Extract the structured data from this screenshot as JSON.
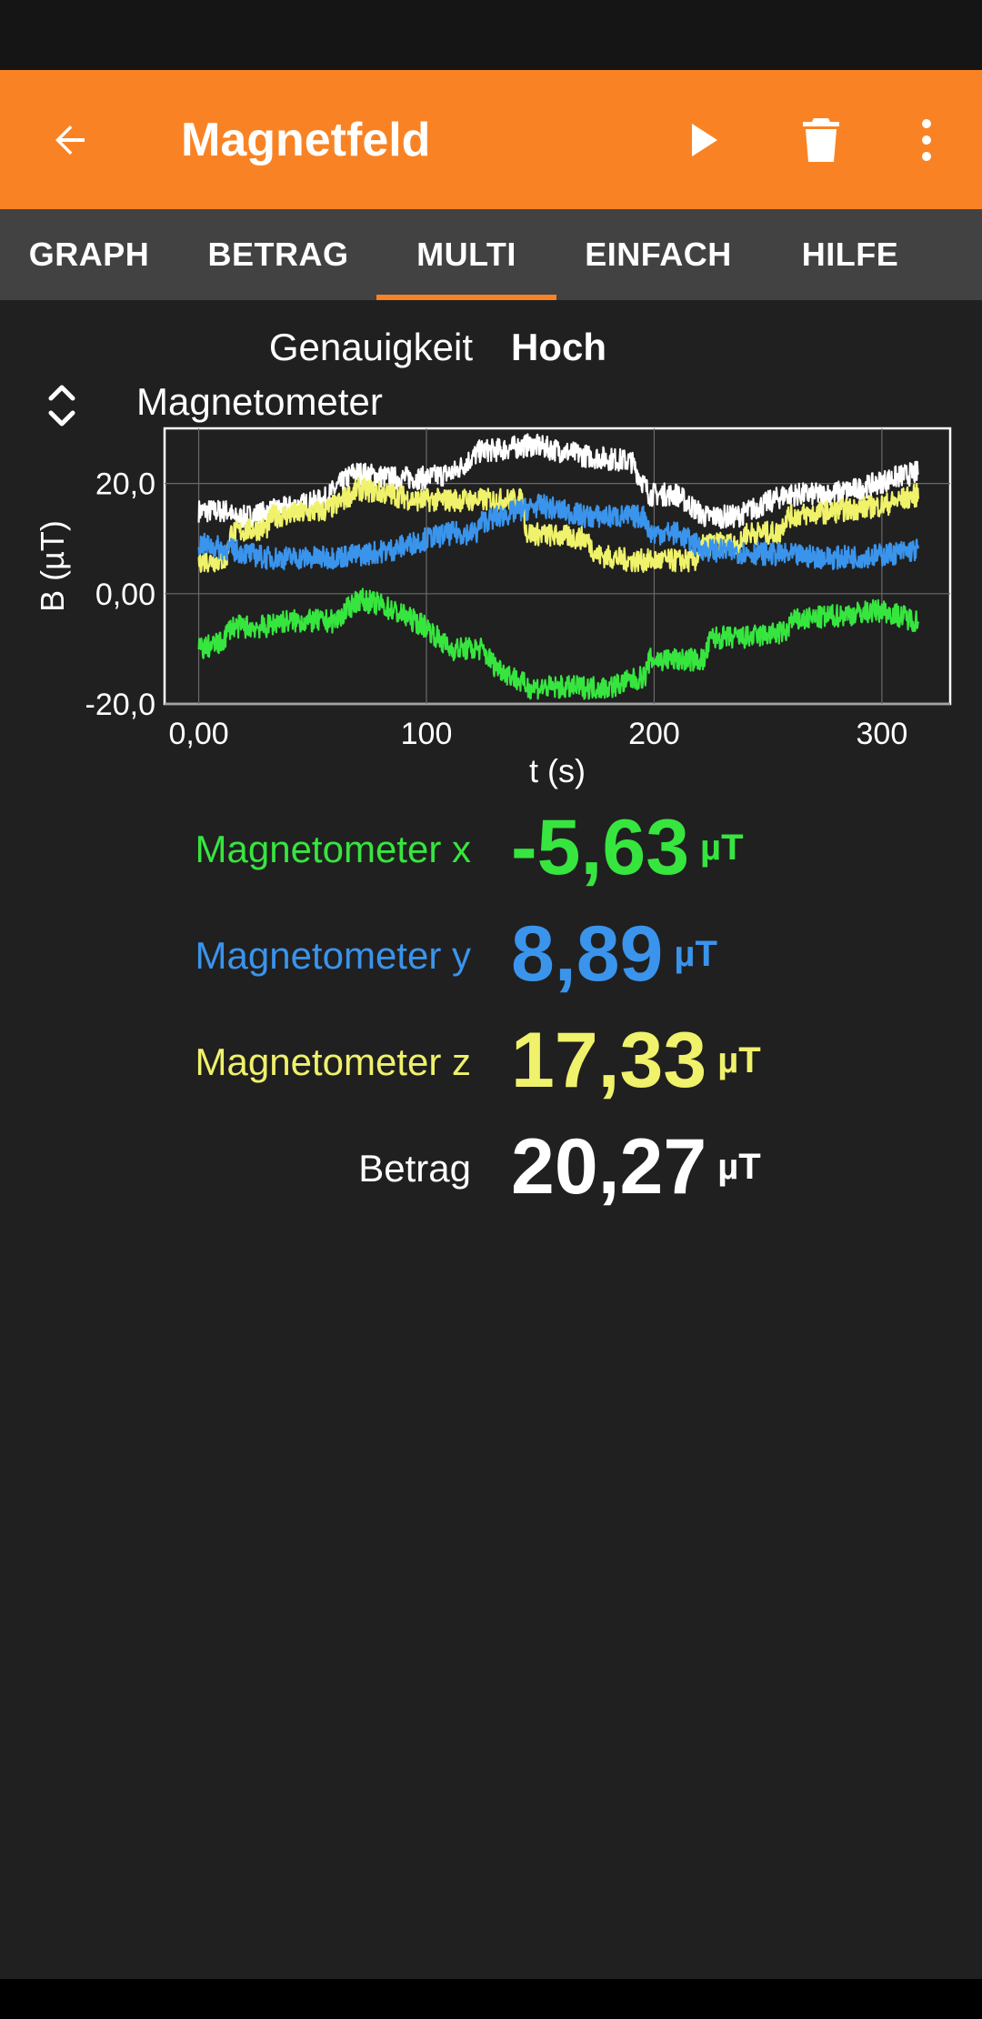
{
  "app_bar": {
    "title": "Magnetfeld",
    "icons": {
      "back": "arrow-back-icon",
      "play": "play-icon",
      "delete": "trash-icon",
      "more": "more-vert-icon"
    }
  },
  "tabs": [
    {
      "label": "GRAPH"
    },
    {
      "label": "BETRAG"
    },
    {
      "label": "MULTI",
      "active": true
    },
    {
      "label": "EINFACH"
    },
    {
      "label": "HILFE"
    }
  ],
  "accuracy": {
    "label": "Genauigkeit",
    "value": "Hoch"
  },
  "chart": {
    "title": "Magnetometer",
    "icon": "expand-collapse-icon"
  },
  "chart_data": {
    "type": "line",
    "xlabel": "t (s)",
    "ylabel": "B (µT)",
    "xlim": [
      -15,
      330
    ],
    "ylim": [
      -20,
      30
    ],
    "xticks": [
      {
        "v": 0,
        "label": "0,00"
      },
      {
        "v": 100,
        "label": "100"
      },
      {
        "v": 200,
        "label": "200"
      },
      {
        "v": 300,
        "label": "300"
      }
    ],
    "yticks": [
      {
        "v": 20,
        "label": "20,0"
      },
      {
        "v": 0,
        "label": "0,00"
      },
      {
        "v": -20,
        "label": "-20,0"
      }
    ],
    "grid": true,
    "series": [
      {
        "name": "Betrag",
        "color": "#ffffff",
        "x": [
          0,
          14,
          15,
          55,
          60,
          68,
          85,
          100,
          112,
          124,
          130,
          146,
          158,
          170,
          190,
          198,
          210,
          222,
          236,
          258,
          275,
          290,
          305,
          316
        ],
        "y": [
          15,
          15,
          13.5,
          17,
          19,
          22,
          21,
          21,
          22,
          26,
          26,
          27,
          26,
          25,
          24,
          18,
          18,
          14,
          14,
          18,
          18,
          19,
          21,
          22
        ]
      },
      {
        "name": "Magnetometer z",
        "color": "#eff26a",
        "x": [
          0,
          12,
          14,
          30,
          32,
          55,
          60,
          70,
          85,
          95,
          120,
          124,
          142,
          144,
          170,
          175,
          190,
          205,
          218,
          222,
          238,
          240,
          255,
          258,
          280,
          300,
          316
        ],
        "y": [
          6,
          6,
          11,
          12,
          14,
          15,
          16,
          19,
          18,
          17,
          17,
          17,
          17,
          11,
          10,
          7,
          6,
          6,
          6,
          9,
          9,
          11,
          11,
          14,
          15,
          16,
          18
        ]
      },
      {
        "name": "Magnetometer y",
        "color": "#3a94ec",
        "x": [
          0,
          14,
          30,
          55,
          70,
          85,
          100,
          112,
          122,
          124,
          140,
          150,
          170,
          196,
          198,
          210,
          222,
          258,
          280,
          300,
          316
        ],
        "y": [
          9,
          8,
          6.5,
          6.5,
          7,
          8,
          10,
          11,
          11,
          13,
          15,
          16,
          14,
          14,
          11,
          11,
          8,
          7,
          6.5,
          7,
          8
        ]
      },
      {
        "name": "Magnetometer x",
        "color": "#37e53f",
        "x": [
          0,
          10,
          14,
          30,
          35,
          60,
          70,
          80,
          100,
          110,
          124,
          130,
          145,
          160,
          180,
          196,
          198,
          210,
          222,
          225,
          240,
          258,
          260,
          280,
          300,
          316
        ],
        "y": [
          -10,
          -9,
          -6,
          -6,
          -5,
          -5,
          -1,
          -2,
          -6,
          -10,
          -10,
          -13,
          -17,
          -17,
          -17,
          -15,
          -12,
          -12,
          -12,
          -8,
          -8,
          -7,
          -5,
          -4,
          -3,
          -5
        ]
      }
    ]
  },
  "readings": [
    {
      "label": "Magnetometer x",
      "value": "-5,63",
      "unit": "µT",
      "color": "#37e53f"
    },
    {
      "label": "Magnetometer y",
      "value": "8,89",
      "unit": "µT",
      "color": "#3a94ec"
    },
    {
      "label": "Magnetometer z",
      "value": "17,33",
      "unit": "µT",
      "color": "#eff26a"
    },
    {
      "label": "Betrag",
      "value": "20,27",
      "unit": "µT",
      "color": "#ffffff"
    }
  ]
}
